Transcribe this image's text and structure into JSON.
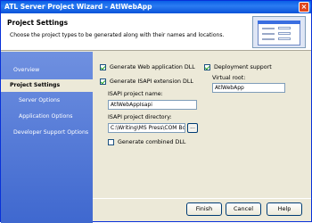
{
  "window": {
    "title": "ATL Server Project Wizard - AtlWebApp",
    "close_glyph": "×"
  },
  "header": {
    "title": "Project Settings",
    "description": "Choose the project types to be generated along with their names and locations."
  },
  "sidebar": {
    "items": [
      {
        "label": "Overview"
      },
      {
        "label": "Project Settings"
      },
      {
        "label": "Server Options"
      },
      {
        "label": "Application Options"
      },
      {
        "label": "Developer Support Options"
      }
    ]
  },
  "options": {
    "generate_web_app_dll": {
      "label": "Generate Web application DLL",
      "checked": true
    },
    "generate_isapi_dll": {
      "label": "Generate ISAPI extension DLL",
      "checked": true
    },
    "isapi_project_name_label": "ISAPI project name:",
    "isapi_project_name_value": "AtlWebAppIsapi",
    "isapi_project_dir_label": "ISAPI project directory:",
    "isapi_project_dir_value": "C:\\Writing\\MS Press\\COM Boo",
    "browse_label": "...",
    "generate_combined_dll": {
      "label": "Generate combined DLL",
      "checked": false
    },
    "deployment_support": {
      "label": "Deployment support",
      "checked": true
    },
    "virtual_root_label": "Virtual root:",
    "virtual_root_value": "AtlWebApp"
  },
  "footer": {
    "finish_label": "Finish",
    "cancel_label": "Cancel",
    "help_label": "Help"
  }
}
